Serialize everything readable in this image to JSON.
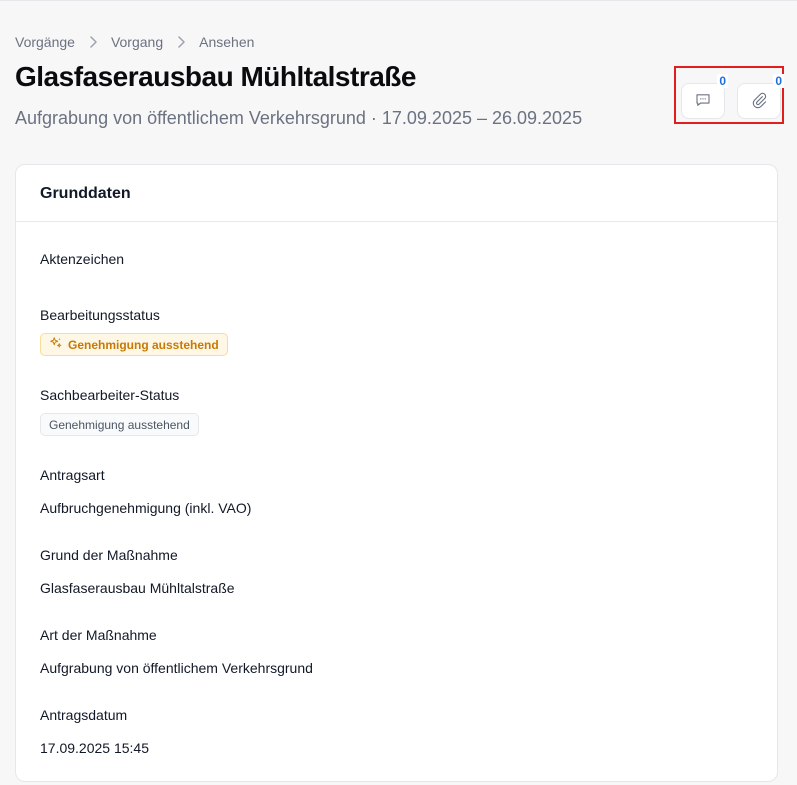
{
  "breadcrumb": {
    "items": [
      "Vorgänge",
      "Vorgang",
      "Ansehen"
    ]
  },
  "header": {
    "title": "Glasfaserausbau Mühltalstraße",
    "subtitle": "Aufgrabung von öffentlichem Verkehrsgrund · 17.09.2025 – 26.09.2025"
  },
  "actions": {
    "comments_count": "0",
    "attachments_count": "0"
  },
  "card": {
    "title": "Grunddaten",
    "fields": {
      "aktenzeichen": {
        "label": "Aktenzeichen",
        "value": ""
      },
      "bearbeitungsstatus": {
        "label": "Bearbeitungsstatus",
        "badge": "Genehmigung ausstehend"
      },
      "sachbearbeiter_status": {
        "label": "Sachbearbeiter-Status",
        "badge": "Genehmigung ausstehend"
      },
      "antragsart": {
        "label": "Antragsart",
        "value": "Aufbruchgenehmigung (inkl. VAO)"
      },
      "grund": {
        "label": "Grund der Maßnahme",
        "value": "Glasfaserausbau Mühltalstraße"
      },
      "art": {
        "label": "Art der Maßnahme",
        "value": "Aufgrabung von öffentlichem Verkehrsgrund"
      },
      "antragsdatum": {
        "label": "Antragsdatum",
        "value": "17.09.2025 15:45"
      }
    }
  },
  "colors": {
    "accent_blue": "#1d6fe0",
    "warn_text": "#c77a06",
    "warn_bg": "#fef7e6",
    "highlight_border": "#e01e1e"
  }
}
